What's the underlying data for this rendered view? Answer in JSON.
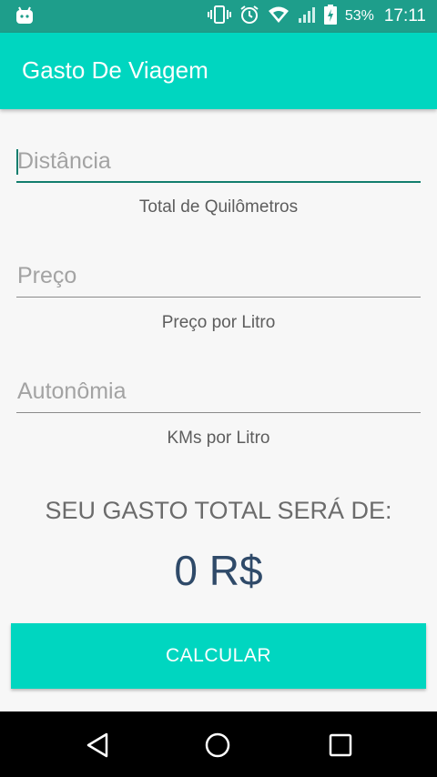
{
  "status_bar": {
    "battery_percent": "53%",
    "time": "17:11",
    "icons": [
      "android-icon",
      "vibrate-icon",
      "alarm-icon",
      "wifi-icon",
      "signal-icon",
      "battery-charging-icon"
    ]
  },
  "app_bar": {
    "title": "Gasto De Viagem"
  },
  "form": {
    "distance": {
      "placeholder": "Distância",
      "value": "",
      "helper": "Total de Quilômetros"
    },
    "price": {
      "placeholder": "Preço",
      "value": "",
      "helper": "Preço por Litro"
    },
    "autonomy": {
      "placeholder": "Autonômia",
      "value": "",
      "helper": "KMs por Litro"
    }
  },
  "result": {
    "label": "SEU GASTO TOTAL SERÁ DE:",
    "value": "0 R$"
  },
  "calculate_button": {
    "label": "CALCULAR"
  },
  "nav_bar": {
    "icons": [
      "back-icon",
      "home-icon",
      "recents-icon"
    ]
  },
  "colors": {
    "status_bar": "#1e9e8b",
    "accent": "#00d6c0",
    "focus_line": "#127e6e",
    "result_value": "#2f4a69"
  }
}
